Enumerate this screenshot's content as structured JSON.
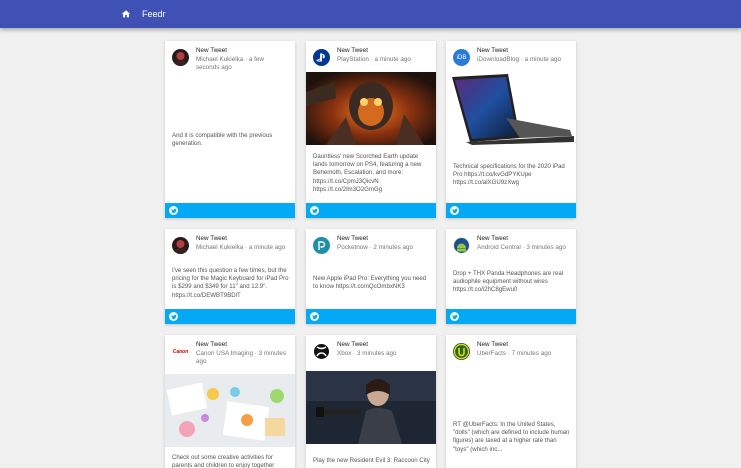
{
  "app": {
    "title": "Feedr",
    "colors": {
      "appbar": "#3f51b5",
      "footer": "#03a9f4"
    }
  },
  "cards": [
    {
      "title": "New Tweet",
      "author": "Michael Kukielka",
      "time": "a few seconds ago",
      "text": "And it is compatible with the previous generation.",
      "avatar_icon": "profile-photo-icon"
    },
    {
      "title": "New Tweet",
      "author": "PlayStation",
      "time": "a minute ago",
      "text": "Dauntless' new Scorched Earth update lands tomorrow on PS4, featuring a new Behemoth, Escalation, and more: https://t.co/CpmJ3QicvN https://t.co/2lm3O2GmGg",
      "avatar_icon": "playstation-logo-icon"
    },
    {
      "title": "New Tweet",
      "author": "iDownloadBlog",
      "time": "a minute ago",
      "text": "Technical specifications for the 2020 iPad Pro https://t.co/kvGdPYKUpe https://t.co/alXGU9zXwg",
      "avatar_icon": "idb-logo-icon",
      "avatar_text": "iDB"
    },
    {
      "title": "New Tweet",
      "author": "Michael Kukielka",
      "time": "a minute ago",
      "text": "I've seen this question a few times, but the pricing for the Magic Keyboard for iPad Pro is $299 and $349 for 11\" and 12.9\". https://t.co/DEWBT9BDlT",
      "avatar_icon": "profile-photo-icon"
    },
    {
      "title": "New Tweet",
      "author": "Pocketnow",
      "time": "2 minutes ago",
      "text": "New Apple iPad Pro: Everything you need to know https://t.co/nQcOmbxNK3",
      "avatar_icon": "pocketnow-logo-icon"
    },
    {
      "title": "New Tweet",
      "author": "Android Central",
      "time": "3 minutes ago",
      "text": "Drop + THX Panda Headphones are real audiophile equipment without wires https://t.co/i2hC8gEwu0",
      "avatar_icon": "android-central-logo-icon"
    },
    {
      "title": "New Tweet",
      "author": "Canon USA Imaging",
      "time": "3 minutes ago",
      "text": "Check out some creative activities for parents and children to enjoy together",
      "avatar_icon": "canon-logo-icon",
      "avatar_text": "Canon"
    },
    {
      "title": "New Tweet",
      "author": "Xbox",
      "time": "3 minutes ago",
      "text": "Play the new Resident Evil 3: Raccoon City",
      "avatar_icon": "xbox-logo-icon"
    },
    {
      "title": "New Tweet",
      "author": "UberFacts",
      "time": "7 minutes ago",
      "text": "RT @UberFacts: In the United States, \"dolls\" (which are defined to include human figures) are taxed at a higher rate than \"toys\" (which inc...",
      "avatar_icon": "uberfacts-logo-icon"
    }
  ]
}
